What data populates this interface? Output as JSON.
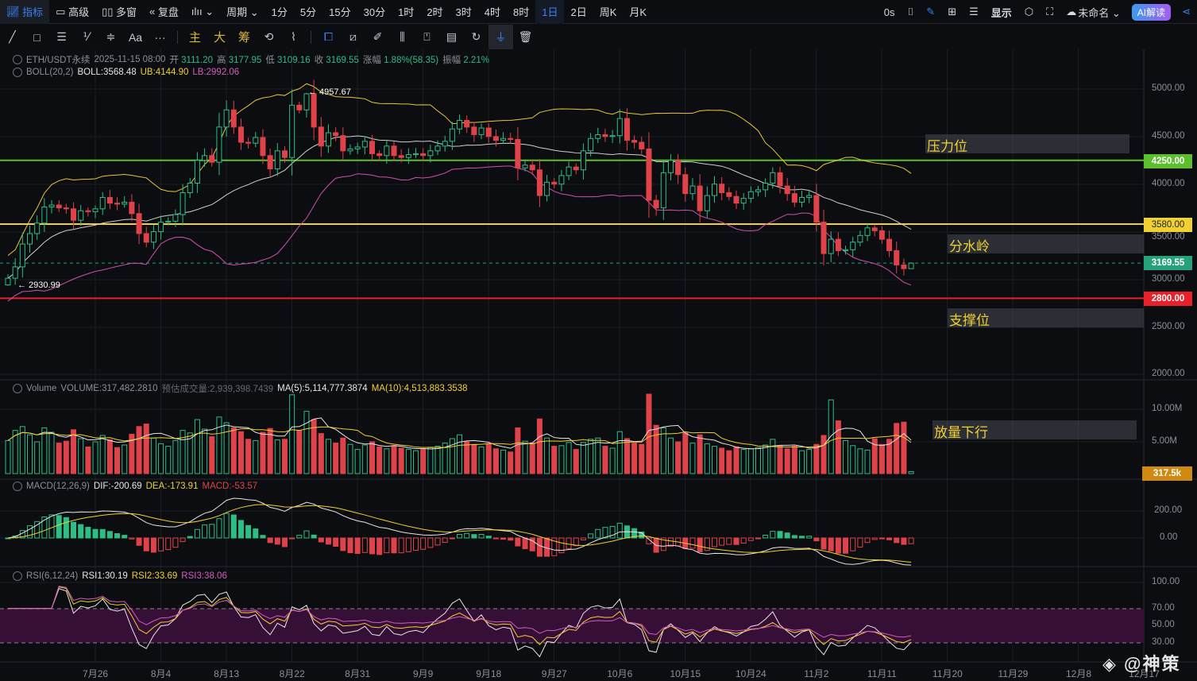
{
  "topbar": {
    "indicators": "指标",
    "advanced": "高级",
    "multi_window": "多窗",
    "replay": "复盘",
    "chart_type": "ılıı ⌄",
    "period": "周期 ⌄",
    "periods": [
      "1分",
      "5分",
      "15分",
      "30分",
      "1时",
      "2时",
      "3时",
      "4时",
      "8时",
      "1日",
      "2日",
      "周K",
      "月K"
    ],
    "selected_period": "1日",
    "countdown": "0s",
    "display": "显示",
    "layout_name": "未命名 ⌄",
    "ai_label": "AI解读"
  },
  "toolbar2": {
    "text_tool": "Aa",
    "more": "···",
    "main": "主",
    "big": "大",
    "chips": "筹"
  },
  "legend": {
    "symbol": "ETH/USDT永续",
    "datetime": "2025-11-15 08:00",
    "open_label": "开",
    "open": "3111.20",
    "high_label": "高",
    "high": "3177.95",
    "low_label": "低",
    "low": "3109.16",
    "close_label": "收",
    "close": "3169.55",
    "change_label": "涨幅",
    "change": "1.88%(58.35)",
    "amp_label": "振幅",
    "amp": "2.21%",
    "boll": "BOLL(20,2)",
    "boll_val": "BOLL:3568.48",
    "ub": "UB:4144.90",
    "lb": "LB:2992.06",
    "vol": "Volume",
    "vol_val": "VOLUME:317,482.2810",
    "est": "预估成交量:2,939,398.7439",
    "ma5": "MA(5):5,114,777.3874",
    "ma10": "MA(10):4,513,883.3538",
    "macd": "MACD(12,26,9)",
    "dif": "DIF:-200.69",
    "dea": "DEA:-173.91",
    "macd_val": "MACD:-53.57",
    "rsi": "RSI(6,12,24)",
    "rsi1": "RSI1:30.19",
    "rsi2": "RSI2:33.69",
    "rsi3": "RSI3:38.06"
  },
  "annotations": {
    "resistance": "压力位",
    "watershed": "分水岭",
    "support": "支撑位",
    "volume_down": "放量下行",
    "high_mark": "← 4957.67",
    "low_mark": "← 2930.99"
  },
  "price_tags": {
    "resistance": "4250.00",
    "watershed": "3580.00",
    "current": "3169.55",
    "support": "2800.00",
    "volume": "317.5k"
  },
  "axes": {
    "price": [
      "5000.00",
      "4500.00",
      "4000.00",
      "3500.00",
      "3000.00",
      "2500.00",
      "2000.00"
    ],
    "volume": [
      "10.00M",
      "5.00M"
    ],
    "macd": [
      "200.00",
      "0.00"
    ],
    "rsi": [
      "100.00",
      "70.00",
      "50.00",
      "30.00"
    ],
    "dates": [
      "7月26",
      "8月4",
      "8月13",
      "8月22",
      "8月31",
      "9月9",
      "9月18",
      "9月27",
      "10月6",
      "10月15",
      "10月24",
      "11月2",
      "11月11",
      "11月20",
      "11月29",
      "12月8",
      "12月17"
    ],
    "date_index": [
      12,
      21,
      30,
      39,
      48,
      57,
      66,
      75,
      84,
      93,
      102,
      111,
      120,
      129,
      138,
      147,
      156
    ]
  },
  "watermark": "@神策",
  "colors": {
    "up": "#2ebd85",
    "down": "#e0424a",
    "resistance": "#5cc02e",
    "watershed": "#f0d032",
    "support": "#e8202a",
    "current": "#26a17b"
  },
  "chart_data": {
    "type": "candlestick",
    "symbol": "ETH/USDT",
    "interval": "1D",
    "start_date": "2025-07-14",
    "closes": [
      3010,
      3130,
      3370,
      3480,
      3590,
      3760,
      3780,
      3750,
      3740,
      3620,
      3720,
      3710,
      3740,
      3860,
      3800,
      3790,
      3810,
      3690,
      3480,
      3390,
      3500,
      3600,
      3610,
      3680,
      3910,
      4010,
      4250,
      4300,
      4230,
      4600,
      4780,
      4600,
      4440,
      4430,
      4490,
      4300,
      4160,
      4350,
      4280,
      4830,
      4780,
      4950,
      4600,
      4400,
      4540,
      4510,
      4350,
      4370,
      4390,
      4450,
      4320,
      4300,
      4400,
      4300,
      4280,
      4310,
      4320,
      4300,
      4350,
      4400,
      4450,
      4580,
      4670,
      4600,
      4520,
      4590,
      4500,
      4460,
      4480,
      4470,
      4170,
      4200,
      4150,
      3880,
      4020,
      4000,
      4090,
      4180,
      4150,
      4350,
      4480,
      4520,
      4500,
      4510,
      4690,
      4460,
      4440,
      4370,
      3830,
      3750,
      4120,
      4250,
      4100,
      3900,
      3980,
      3720,
      3880,
      4000,
      3910,
      3870,
      3800,
      3850,
      3920,
      3940,
      4010,
      4120,
      3980,
      3900,
      3810,
      3860,
      3880,
      3600,
      3270,
      3420,
      3300,
      3310,
      3390,
      3460,
      3540,
      3510,
      3420,
      3300,
      3150,
      3111.2,
      3169.55
    ],
    "first_open": 2940,
    "volumes_m": [
      5.2,
      6.8,
      7.4,
      6.1,
      5.0,
      7.2,
      6.5,
      4.8,
      5.1,
      6.9,
      5.5,
      4.2,
      5.0,
      6.0,
      5.3,
      4.1,
      4.5,
      6.2,
      7.4,
      7.8,
      5.6,
      4.7,
      4.3,
      5.2,
      6.8,
      6.4,
      8.5,
      7.0,
      5.8,
      8.9,
      8.0,
      7.2,
      6.6,
      5.4,
      5.2,
      6.5,
      7.1,
      5.3,
      5.4,
      12.4,
      6.8,
      9.8,
      8.5,
      6.3,
      5.4,
      4.8,
      5.6,
      4.6,
      3.8,
      4.5,
      5.0,
      4.2,
      3.9,
      4.4,
      4.0,
      3.8,
      3.6,
      3.9,
      4.1,
      4.3,
      4.8,
      5.5,
      6.1,
      5.0,
      4.6,
      4.2,
      4.7,
      3.9,
      3.7,
      3.4,
      7.2,
      5.1,
      4.8,
      8.6,
      5.6,
      4.3,
      4.4,
      4.9,
      3.8,
      4.9,
      5.4,
      5.6,
      4.3,
      4.0,
      6.6,
      5.5,
      4.8,
      4.6,
      12.5,
      7.6,
      7.2,
      5.6,
      5.0,
      6.4,
      4.8,
      6.1,
      4.7,
      4.3,
      4.0,
      3.6,
      4.2,
      3.8,
      3.9,
      4.1,
      4.5,
      5.4,
      4.4,
      3.9,
      4.3,
      3.6,
      3.8,
      4.6,
      6.0,
      11.6,
      8.3,
      5.2,
      4.4,
      3.9,
      3.7,
      5.5,
      4.6,
      5.4,
      7.9,
      8.1,
      0.32
    ]
  }
}
